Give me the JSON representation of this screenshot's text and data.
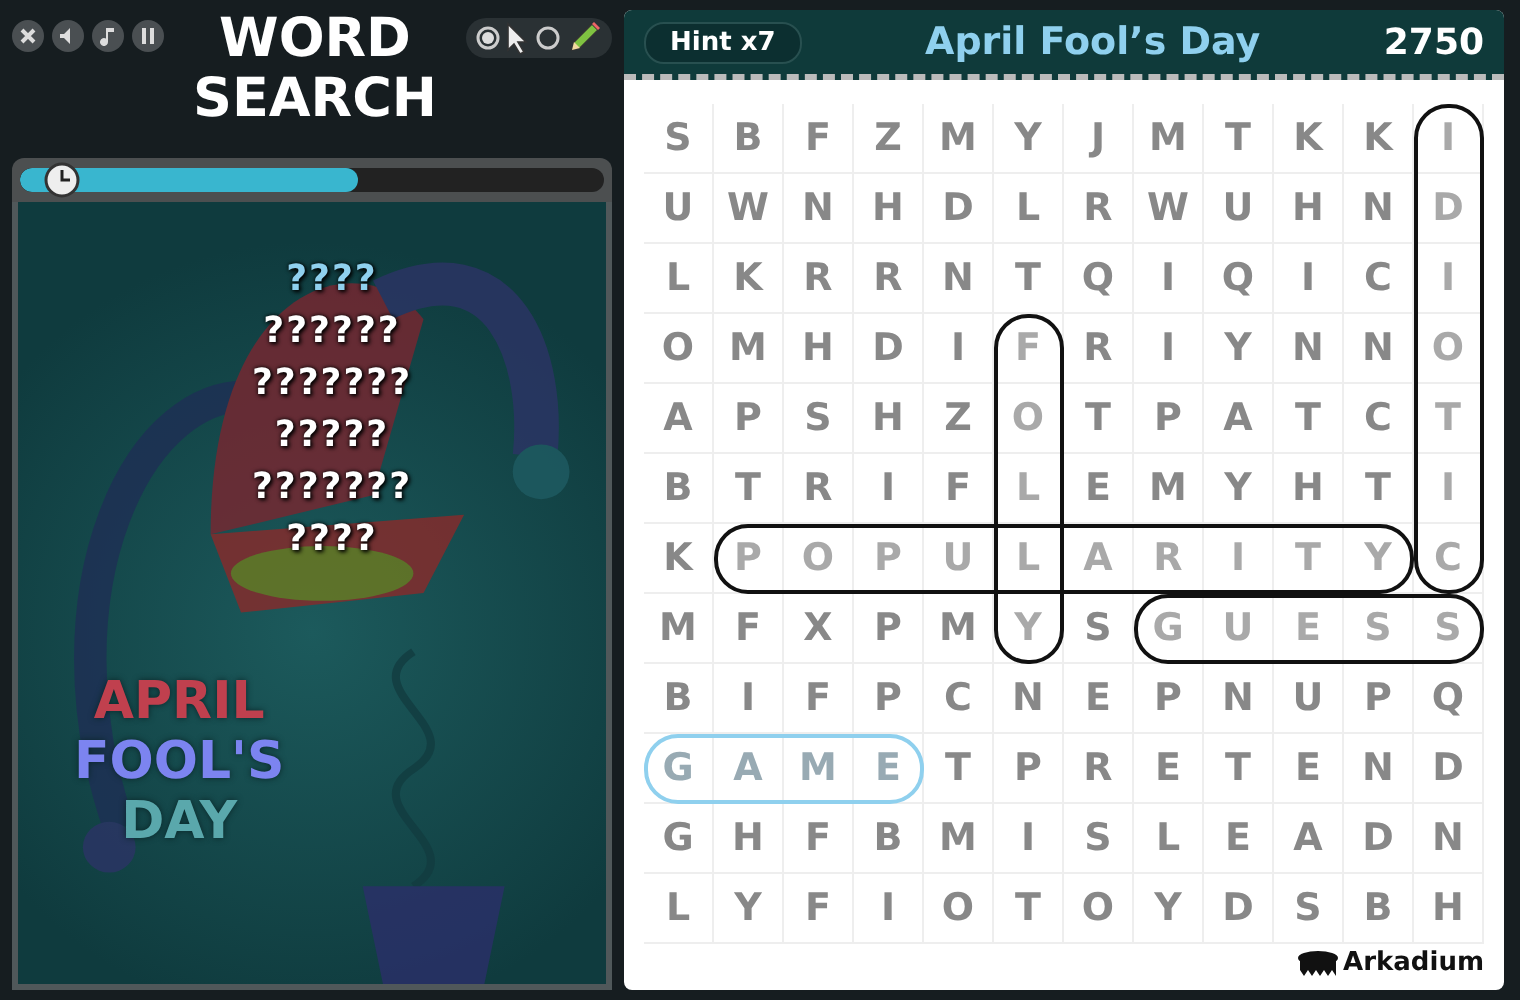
{
  "game_title": [
    "WORD",
    "SEARCH"
  ],
  "timer": {
    "level": 0.58
  },
  "words": [
    {
      "text": "????",
      "found": true
    },
    {
      "text": "??????",
      "found": false
    },
    {
      "text": "???????",
      "found": false
    },
    {
      "text": "?????",
      "found": false
    },
    {
      "text": "???????",
      "found": false
    },
    {
      "text": "????",
      "found": false
    }
  ],
  "art_title": [
    "APRIL",
    "FOOL'S",
    "DAY"
  ],
  "header": {
    "hint": "Hint x7",
    "title": "April Fool’s Day",
    "score": "2750"
  },
  "grid": [
    [
      {
        "l": "S"
      },
      {
        "l": "B"
      },
      {
        "l": "F"
      },
      {
        "l": "Z"
      },
      {
        "l": "M"
      },
      {
        "l": "Y"
      },
      {
        "l": "J"
      },
      {
        "l": "M"
      },
      {
        "l": "T"
      },
      {
        "l": "K"
      },
      {
        "l": "K"
      },
      {
        "l": "I",
        "ring_v": true
      }
    ],
    [
      {
        "l": "U"
      },
      {
        "l": "W"
      },
      {
        "l": "N"
      },
      {
        "l": "H"
      },
      {
        "l": "D"
      },
      {
        "l": "L"
      },
      {
        "l": "R"
      },
      {
        "l": "W"
      },
      {
        "l": "U"
      },
      {
        "l": "H"
      },
      {
        "l": "N"
      },
      {
        "l": "D",
        "ring_v": true
      }
    ],
    [
      {
        "l": "L"
      },
      {
        "l": "K"
      },
      {
        "l": "R"
      },
      {
        "l": "R"
      },
      {
        "l": "N"
      },
      {
        "l": "T"
      },
      {
        "l": "Q"
      },
      {
        "l": "I"
      },
      {
        "l": "Q"
      },
      {
        "l": "I"
      },
      {
        "l": "C"
      },
      {
        "l": "I",
        "ring_v": true
      }
    ],
    [
      {
        "l": "O"
      },
      {
        "l": "M"
      },
      {
        "l": "H"
      },
      {
        "l": "D"
      },
      {
        "l": "I"
      },
      {
        "l": "F",
        "ring_v": true
      },
      {
        "l": "R"
      },
      {
        "l": "I"
      },
      {
        "l": "Y"
      },
      {
        "l": "N"
      },
      {
        "l": "N"
      },
      {
        "l": "O",
        "ring_v": true
      }
    ],
    [
      {
        "l": "A"
      },
      {
        "l": "P"
      },
      {
        "l": "S"
      },
      {
        "l": "H"
      },
      {
        "l": "Z"
      },
      {
        "l": "O",
        "ring_v": true
      },
      {
        "l": "T"
      },
      {
        "l": "P"
      },
      {
        "l": "A"
      },
      {
        "l": "T"
      },
      {
        "l": "C"
      },
      {
        "l": "T",
        "ring_v": true
      }
    ],
    [
      {
        "l": "B"
      },
      {
        "l": "T"
      },
      {
        "l": "R"
      },
      {
        "l": "I"
      },
      {
        "l": "F"
      },
      {
        "l": "L",
        "ring_v": true
      },
      {
        "l": "E"
      },
      {
        "l": "M"
      },
      {
        "l": "Y"
      },
      {
        "l": "H"
      },
      {
        "l": "T"
      },
      {
        "l": "I",
        "ring_v": true
      }
    ],
    [
      {
        "l": "K"
      },
      {
        "l": "P",
        "ring_h": true
      },
      {
        "l": "O",
        "ring_h": true
      },
      {
        "l": "P",
        "ring_h": true
      },
      {
        "l": "U",
        "ring_h": true
      },
      {
        "l": "L",
        "ring_v": true,
        "ring_h": true
      },
      {
        "l": "A",
        "ring_h": true
      },
      {
        "l": "R",
        "ring_h": true
      },
      {
        "l": "I",
        "ring_h": true
      },
      {
        "l": "T",
        "ring_h": true
      },
      {
        "l": "Y",
        "ring_h": true
      },
      {
        "l": "C",
        "ring_v": true
      }
    ],
    [
      {
        "l": "M"
      },
      {
        "l": "F"
      },
      {
        "l": "X"
      },
      {
        "l": "P"
      },
      {
        "l": "M"
      },
      {
        "l": "Y",
        "ring_v": true
      },
      {
        "l": "S"
      },
      {
        "l": "G",
        "ring_h": true
      },
      {
        "l": "U",
        "ring_h": true
      },
      {
        "l": "E",
        "ring_h": true
      },
      {
        "l": "S",
        "ring_h": true
      },
      {
        "l": "S",
        "ring_h": true
      }
    ],
    [
      {
        "l": "B"
      },
      {
        "l": "I"
      },
      {
        "l": "F"
      },
      {
        "l": "P"
      },
      {
        "l": "C"
      },
      {
        "l": "N"
      },
      {
        "l": "E"
      },
      {
        "l": "P"
      },
      {
        "l": "N"
      },
      {
        "l": "U"
      },
      {
        "l": "P"
      },
      {
        "l": "Q"
      }
    ],
    [
      {
        "l": "G",
        "ring_h": true,
        "hint": true
      },
      {
        "l": "A",
        "ring_h": true,
        "hint": true
      },
      {
        "l": "M",
        "ring_h": true,
        "hint": true
      },
      {
        "l": "E",
        "ring_h": true,
        "hint": true
      },
      {
        "l": "T"
      },
      {
        "l": "P"
      },
      {
        "l": "R"
      },
      {
        "l": "E"
      },
      {
        "l": "T"
      },
      {
        "l": "E"
      },
      {
        "l": "N"
      },
      {
        "l": "D"
      }
    ],
    [
      {
        "l": "G"
      },
      {
        "l": "H"
      },
      {
        "l": "F"
      },
      {
        "l": "B"
      },
      {
        "l": "M"
      },
      {
        "l": "I"
      },
      {
        "l": "S"
      },
      {
        "l": "L"
      },
      {
        "l": "E"
      },
      {
        "l": "A"
      },
      {
        "l": "D"
      },
      {
        "l": "N"
      }
    ],
    [
      {
        "l": "L"
      },
      {
        "l": "Y"
      },
      {
        "l": "F"
      },
      {
        "l": "I"
      },
      {
        "l": "O"
      },
      {
        "l": "T"
      },
      {
        "l": "O"
      },
      {
        "l": "Y"
      },
      {
        "l": "D"
      },
      {
        "l": "S"
      },
      {
        "l": "B"
      },
      {
        "l": "H"
      }
    ]
  ],
  "brand": "Arkadium"
}
